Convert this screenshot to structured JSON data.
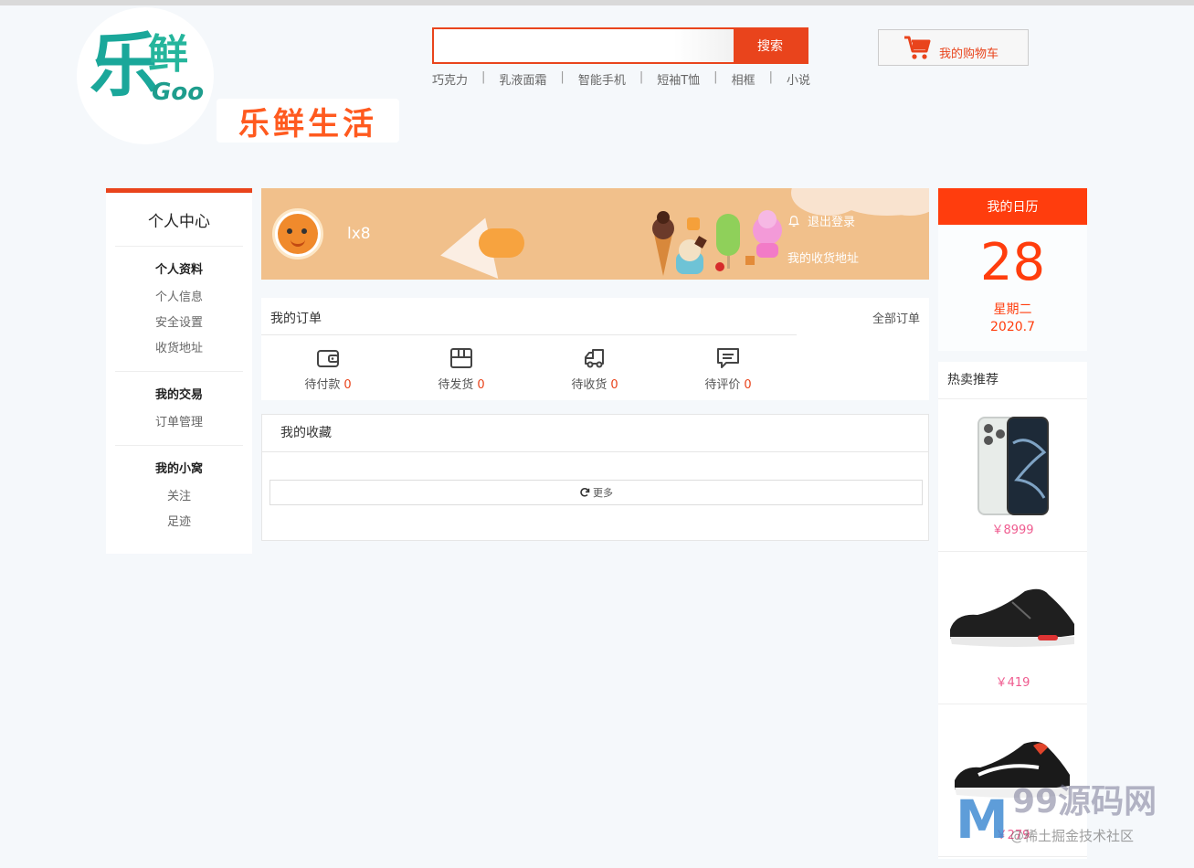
{
  "header": {
    "logo_le": "乐",
    "logo_xian": "鲜",
    "logo_goo": "Goo",
    "brand_name": "乐鲜生活",
    "search": {
      "value": "",
      "placeholder": "",
      "button": "搜索"
    },
    "hotwords": [
      "巧克力",
      "乳液面霜",
      "智能手机",
      "短袖T恤",
      "相框",
      "小说"
    ],
    "hotword_separator": "|",
    "cart_label": "我的购物车"
  },
  "sidebar": {
    "title": "个人中心",
    "groups": [
      {
        "title": "个人资料",
        "items": [
          "个人信息",
          "安全设置",
          "收货地址"
        ]
      },
      {
        "title": "我的交易",
        "items": [
          "订单管理"
        ]
      },
      {
        "title": "我的小窝",
        "items": [
          "关注",
          "足迹"
        ]
      }
    ]
  },
  "user": {
    "username": "lx8",
    "logout": "退出登录",
    "address": "我的收货地址"
  },
  "orders": {
    "title": "我的订单",
    "all": "全部订单",
    "statuses": [
      {
        "label": "待付款",
        "count": "0",
        "icon": "wallet-icon"
      },
      {
        "label": "待发货",
        "count": "0",
        "icon": "package-icon"
      },
      {
        "label": "待收货",
        "count": "0",
        "icon": "truck-icon"
      },
      {
        "label": "待评价",
        "count": "0",
        "icon": "comment-icon"
      }
    ]
  },
  "favorites": {
    "title": "我的收藏",
    "more": "更多"
  },
  "calendar": {
    "title": "我的日历",
    "day": "28",
    "weekday": "星期二",
    "month": "2020.7"
  },
  "hot": {
    "title": "热卖推荐",
    "items": [
      {
        "price": "￥8999",
        "icon": "smartphone-icon"
      },
      {
        "price": "￥419",
        "icon": "sneaker-icon"
      },
      {
        "price": "￥279",
        "icon": "running-shoe-icon"
      }
    ]
  },
  "watermark": {
    "title": "99源码网",
    "subtitle": "@稀土掘金技术社区"
  },
  "colors": {
    "accent": "#e9441c",
    "calendar_red": "#ff3d0d",
    "banner": "#f1c08b",
    "price_pink": "#ef5b8f"
  }
}
